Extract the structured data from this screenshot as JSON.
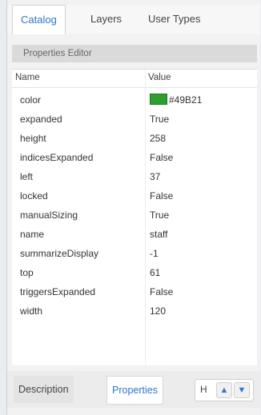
{
  "tabs": {
    "catalog": "Catalog",
    "layers": "Layers",
    "user_types": "User Types"
  },
  "panel": {
    "title": "Properties Editor"
  },
  "grid": {
    "header_name": "Name",
    "header_value": "Value",
    "rows": [
      {
        "name": "color",
        "value": "#49B21"
      },
      {
        "name": "expanded",
        "value": "True"
      },
      {
        "name": "height",
        "value": "258"
      },
      {
        "name": "indicesExpanded",
        "value": "False"
      },
      {
        "name": "left",
        "value": "37"
      },
      {
        "name": "locked",
        "value": "False"
      },
      {
        "name": "manualSizing",
        "value": "True"
      },
      {
        "name": "name",
        "value": "staff"
      },
      {
        "name": "summarizeDisplay",
        "value": "-1"
      },
      {
        "name": "top",
        "value": "61"
      },
      {
        "name": "triggersExpanded",
        "value": "False"
      },
      {
        "name": "width",
        "value": "120"
      }
    ],
    "swatch_color": "#2f9e31"
  },
  "bottom": {
    "description_tab": "Description",
    "properties_tab": "Properties",
    "control_label": "H",
    "up_icon": "chevron-up-icon",
    "down_icon": "chevron-down-icon"
  }
}
